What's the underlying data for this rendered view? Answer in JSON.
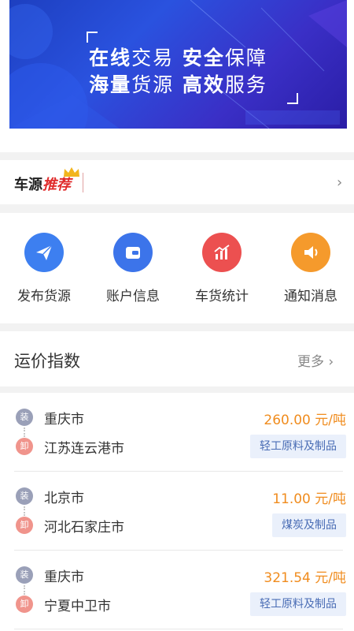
{
  "banner": {
    "line1_a": "在线",
    "line1_b": "交易",
    "line1_c": "安全",
    "line1_d": "保障",
    "line2_a": "海量",
    "line2_b": "货源",
    "line2_c": "高效",
    "line2_d": "服务"
  },
  "recommend": {
    "title_a": "车源",
    "title_b": "推荐",
    "chevron": "›"
  },
  "grid": [
    {
      "label": "发布货源",
      "icon": "send-icon",
      "color": "#3d7ff0"
    },
    {
      "label": "账户信息",
      "icon": "wallet-icon",
      "color": "#3c74ea"
    },
    {
      "label": "车货统计",
      "icon": "chart-icon",
      "color": "#ec5050"
    },
    {
      "label": "通知消息",
      "icon": "speaker-icon",
      "color": "#f59a2c"
    }
  ],
  "index": {
    "title": "运价指数",
    "more": "更多 ›"
  },
  "routes": [
    {
      "load_tag": "装",
      "unload_tag": "卸",
      "from": "重庆市",
      "to": "江苏连云港市",
      "price": "260.00 元/吨",
      "cargo": "轻工原料及制品"
    },
    {
      "load_tag": "装",
      "unload_tag": "卸",
      "from": "北京市",
      "to": "河北石家庄市",
      "price": "11.00 元/吨",
      "cargo": "煤炭及制品"
    },
    {
      "load_tag": "装",
      "unload_tag": "卸",
      "from": "重庆市",
      "to": "宁夏中卫市",
      "price": "321.54 元/吨",
      "cargo": "轻工原料及制品"
    }
  ]
}
